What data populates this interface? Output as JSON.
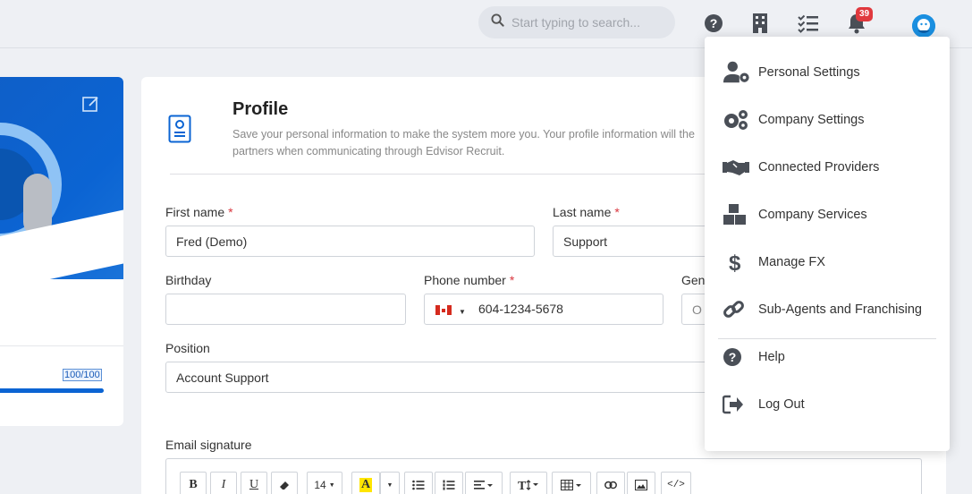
{
  "topbar": {
    "search_placeholder": "Start typing to search...",
    "notification_count": "39",
    "icons": [
      "help-icon",
      "building-icon",
      "tasks-icon",
      "bell-icon",
      "avatar"
    ]
  },
  "left_card": {
    "progress_label": "100/100",
    "progress_value": 1.0
  },
  "profile": {
    "title": "Profile",
    "description": "Save your personal information to make the system more you. Your profile information will the partners when communicating through Edvisor Recruit.",
    "description_line1": "Save your personal information to make the system more you. Your profile information will the",
    "description_line2": "partners when communicating through Edvisor Recruit."
  },
  "form": {
    "first_name_label": "First name",
    "first_name_value": "Fred (Demo)",
    "last_name_label": "Last name",
    "last_name_value": "Support",
    "required_mark": "*",
    "birthday_label": "Birthday",
    "birthday_value": "",
    "phone_label": "Phone number",
    "phone_value": "604-1234-5678",
    "gender_label": "Gen",
    "gender_value": "O",
    "position_label": "Position",
    "position_value": "Account Support",
    "email_signature_label": "Email signature"
  },
  "editor_toolbar": {
    "bold": "B",
    "italic": "I",
    "underline": "U",
    "font_size": "14",
    "highlight": "A"
  },
  "menu": {
    "items": [
      {
        "label": "Personal Settings",
        "icon": "user-cog-icon"
      },
      {
        "label": "Company Settings",
        "icon": "cogs-icon"
      },
      {
        "label": "Connected Providers",
        "icon": "handshake-icon"
      },
      {
        "label": "Company Services",
        "icon": "boxes-icon"
      },
      {
        "label": "Manage FX",
        "icon": "dollar-icon"
      },
      {
        "label": "Sub-Agents and Franchising",
        "icon": "link-icon"
      },
      {
        "label": "Help",
        "icon": "help-icon"
      },
      {
        "label": "Log Out",
        "icon": "logout-icon"
      }
    ]
  },
  "colors": {
    "accent": "#0b64d3",
    "required": "#d9363e",
    "badge": "#e0393e",
    "icon": "#4a4f57"
  }
}
